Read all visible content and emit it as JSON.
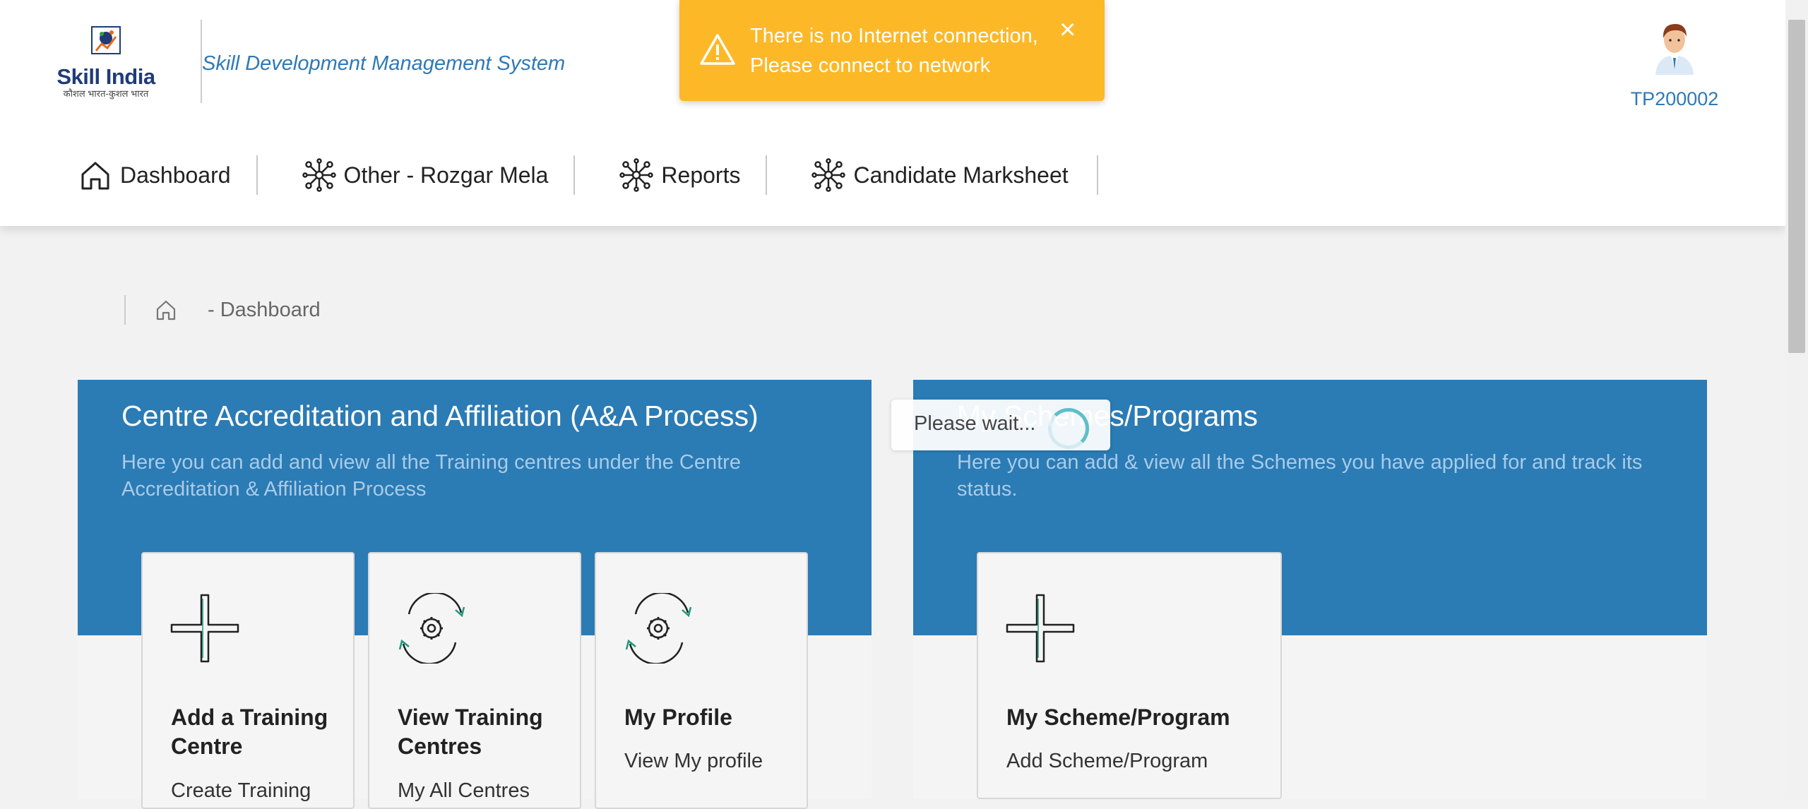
{
  "header": {
    "logo": {
      "title": "Skill India",
      "tagline": "कौशल भारत-कुशल भारत"
    },
    "app_title": "Skill Development Management System",
    "user": {
      "id": "TP200002"
    }
  },
  "nav": {
    "items": [
      {
        "label": "Dashboard",
        "icon": "home-icon"
      },
      {
        "label": "Other - Rozgar Mela",
        "icon": "network-icon"
      },
      {
        "label": "Reports",
        "icon": "network-icon"
      },
      {
        "label": "Candidate Marksheet",
        "icon": "network-icon"
      }
    ]
  },
  "toast": {
    "message": "There is no Internet connection, Please connect to network",
    "close_glyph": "×",
    "color": "#fdb827"
  },
  "breadcrumb": {
    "separator": "-",
    "current": "Dashboard"
  },
  "panels": [
    {
      "title": "Centre Accreditation and Affiliation (A&A Process)",
      "description": "Here you can add and view all the Training centres under the Centre Accreditation & Affiliation Process",
      "cards": [
        {
          "title": "Add a Training Centre",
          "subtitle": "Create Training",
          "icon": "plus-icon"
        },
        {
          "title": "View Training Centres",
          "subtitle": "My All Centres",
          "icon": "gear-refresh-icon"
        },
        {
          "title": "My Profile",
          "subtitle": "View My profile",
          "icon": "gear-refresh-icon"
        }
      ]
    },
    {
      "title": "My Schemes/Programs",
      "description": "Here you can add & view all the Schemes you have applied for and track its status.",
      "cards": [
        {
          "title": "My Scheme/Program",
          "subtitle": "Add Scheme/Program",
          "icon": "plus-icon"
        }
      ]
    }
  ],
  "loading": {
    "text": "Please wait..."
  },
  "colors": {
    "primary": "#2b7bb5",
    "accent_text": "#2f79b5",
    "warning": "#fdb827"
  }
}
